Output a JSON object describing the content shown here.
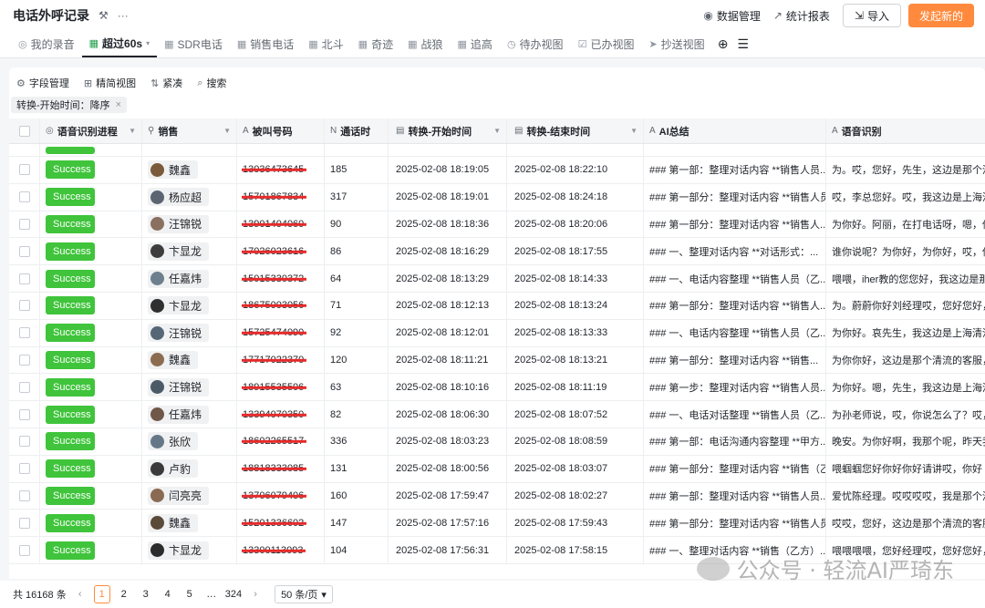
{
  "header": {
    "title": "电话外呼记录",
    "data_manage": "数据管理",
    "stats_report": "统计报表",
    "import": "导入",
    "new": "发起新的"
  },
  "tabs": [
    {
      "label": "我的录音",
      "icon": "layers-icon"
    },
    {
      "label": "超过60s",
      "icon": "grid-icon",
      "active": true
    },
    {
      "label": "SDR电话",
      "icon": "table-icon"
    },
    {
      "label": "销售电话",
      "icon": "table-icon"
    },
    {
      "label": "北斗",
      "icon": "table-icon"
    },
    {
      "label": "奇迹",
      "icon": "table-icon"
    },
    {
      "label": "战狼",
      "icon": "table-icon"
    },
    {
      "label": "追高",
      "icon": "table-icon"
    },
    {
      "label": "待办视图",
      "icon": "clock-icon"
    },
    {
      "label": "已办视图",
      "icon": "check-icon"
    },
    {
      "label": "抄送视图",
      "icon": "send-icon"
    }
  ],
  "toolbar": {
    "field_manage": "字段管理",
    "compact_view": "精简视图",
    "tight": "紧凑",
    "search": "搜索"
  },
  "filter_chip": "转换-开始时间：降序",
  "columns": {
    "asr_progress": "语音识别进程",
    "sales": "销售",
    "called_number": "被叫号码",
    "duration": "通话时",
    "start_time": "转换-开始时间",
    "end_time": "转换-结束时间",
    "ai_summary": "AI总结",
    "asr": "语音识别"
  },
  "rows": [
    {
      "status": "Success",
      "sales": "魏鑫",
      "phone": "13036473645",
      "duration": "185",
      "start": "2025-02-08 18:19:05",
      "end": "2025-02-08 18:22:10",
      "ai": "### 第一部：整理对话内容 **销售人员...",
      "asr": "为。哎，您好，先生，这边是那个清"
    },
    {
      "status": "Success",
      "sales": "杨应超",
      "phone": "15701867834",
      "duration": "317",
      "start": "2025-02-08 18:19:01",
      "end": "2025-02-08 18:24:18",
      "ai": "### 第一部分：整理对话内容 **销售人员...",
      "asr": "哎，李总您好。哎，我这边是上海清"
    },
    {
      "status": "Success",
      "sales": "汪锦锐",
      "phone": "13901404060",
      "duration": "90",
      "start": "2025-02-08 18:18:36",
      "end": "2025-02-08 18:20:06",
      "ai": "### 第一部分：整理对话内容 **销售人...",
      "asr": "为你好。阿丽，在打电话呀，嗯，你"
    },
    {
      "status": "Success",
      "sales": "卞显龙",
      "phone": "17026023616",
      "duration": "86",
      "start": "2025-02-08 18:16:29",
      "end": "2025-02-08 18:17:55",
      "ai": "### 一、整理对话内容 **对话形式：...",
      "asr": "谁你说呢？为你好，为你好，哎，你"
    },
    {
      "status": "Success",
      "sales": "任嘉炜",
      "phone": "15015330372",
      "duration": "64",
      "start": "2025-02-08 18:13:29",
      "end": "2025-02-08 18:14:33",
      "ai": "### 一、电话内容整理 **销售人员（乙...",
      "asr": "喂喂，iher教的您您好，我这边是那"
    },
    {
      "status": "Success",
      "sales": "卞显龙",
      "phone": "18675003056",
      "duration": "71",
      "start": "2025-02-08 18:12:13",
      "end": "2025-02-08 18:13:24",
      "ai": "### 第一部分：整理对话内容 **销售人...",
      "asr": "为。蔚蔚你好刘经理哎，您好您好，"
    },
    {
      "status": "Success",
      "sales": "汪锦锐",
      "phone": "15725474090",
      "duration": "92",
      "start": "2025-02-08 18:12:01",
      "end": "2025-02-08 18:13:33",
      "ai": "### 一、电话内容整理 **销售人员（乙...",
      "asr": "为你好。哀先生，我这边是上海清流"
    },
    {
      "status": "Success",
      "sales": "魏鑫",
      "phone": "17717022370",
      "duration": "120",
      "start": "2025-02-08 18:11:21",
      "end": "2025-02-08 18:13:21",
      "ai": "### 第一部分：整理对话内容 **销售...",
      "asr": "为你你好，这边是那个清流的客服，"
    },
    {
      "status": "Success",
      "sales": "汪锦锐",
      "phone": "18915535506",
      "duration": "63",
      "start": "2025-02-08 18:10:16",
      "end": "2025-02-08 18:11:19",
      "ai": "### 第一步：整理对话内容 **销售人员...",
      "asr": "为你好。嗯，先生，我这边是上海清"
    },
    {
      "status": "Success",
      "sales": "任嘉炜",
      "phone": "13394070350",
      "duration": "82",
      "start": "2025-02-08 18:06:30",
      "end": "2025-02-08 18:07:52",
      "ai": "### 一、电话对话整理 **销售人员（乙...",
      "asr": "为孙老师说，哎，你说怎么了？哎，"
    },
    {
      "status": "Success",
      "sales": "张欣",
      "phone": "18602265517",
      "duration": "336",
      "start": "2025-02-08 18:03:23",
      "end": "2025-02-08 18:08:59",
      "ai": "### 第一部：电话沟通内容整理 **甲方...",
      "asr": "晚安。为你好啊，我那个呢，昨天我"
    },
    {
      "status": "Success",
      "sales": "卢豹",
      "phone": "18818333085",
      "duration": "131",
      "start": "2025-02-08 18:00:56",
      "end": "2025-02-08 18:03:07",
      "ai": "### 第一部分：整理对话内容 **销售（乙...",
      "asr": "喂蝈蝈您好你好你好请讲哎，你好"
    },
    {
      "status": "Success",
      "sales": "闫亮亮",
      "phone": "13706079406",
      "duration": "160",
      "start": "2025-02-08 17:59:47",
      "end": "2025-02-08 18:02:27",
      "ai": "### 第一部：整理对话内容 **销售人员...",
      "asr": "爱忧陈经理。哎哎哎哎，我是那个清"
    },
    {
      "status": "Success",
      "sales": "魏鑫",
      "phone": "15201336602",
      "duration": "147",
      "start": "2025-02-08 17:57:16",
      "end": "2025-02-08 17:59:43",
      "ai": "### 第一部分：整理对话内容 **销售人员...",
      "asr": "哎哎，您好，这边是那个清流的客服"
    },
    {
      "status": "Success",
      "sales": "卞显龙",
      "phone": "13300113093",
      "duration": "104",
      "start": "2025-02-08 17:56:31",
      "end": "2025-02-08 17:58:15",
      "ai": "### 一、整理对话内容 **销售（乙方）...",
      "asr": "喂喂喂喂，您好经理哎，您好您好，"
    }
  ],
  "footer": {
    "total": "共 16168 条",
    "pages": [
      "1",
      "2",
      "3",
      "4",
      "5"
    ],
    "ellipsis": "…",
    "last_page": "324",
    "page_size": "50 条/页"
  },
  "watermark": "公众号 · 轻流AI严琦东"
}
